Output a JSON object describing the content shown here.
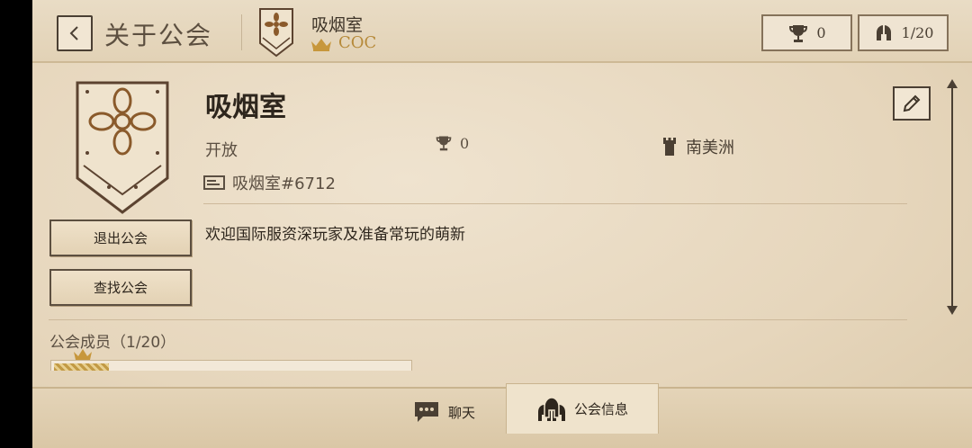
{
  "header": {
    "title": "关于公会",
    "guild_name": "吸烟室",
    "guild_tag": "COC",
    "trophy_count": "0",
    "member_count": "1/20"
  },
  "guild": {
    "name": "吸烟室",
    "status": "开放",
    "trophies": "0",
    "region": "南美洲",
    "id": "吸烟室#6712",
    "description": "欢迎国际服资深玩家及准备常玩的萌新"
  },
  "actions": {
    "leave_label": "退出公会",
    "find_label": "查找公会"
  },
  "members": {
    "title": "公会成员（1/20）"
  },
  "tabs": [
    {
      "label": "聊天",
      "icon": "chat-icon"
    },
    {
      "label": "公会信息",
      "icon": "guild-info-icon"
    }
  ],
  "colors": {
    "parchment": "#e6d6bc",
    "ink": "#3e3428",
    "gold": "#b68a3a"
  }
}
